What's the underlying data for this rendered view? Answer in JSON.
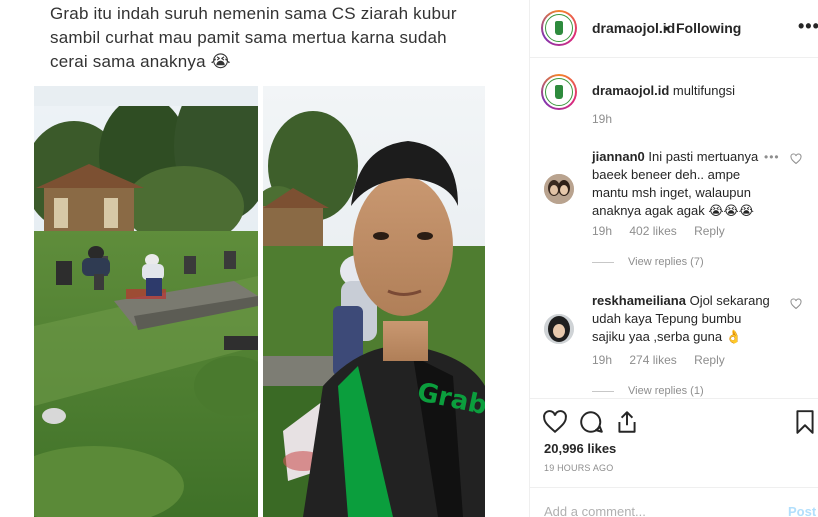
{
  "post": {
    "caption": "Grab itu indah suruh nemenin sama CS ziarah kubur sambil curhat mau pamit sama mertua karna sudah cerai sama anaknya 😭",
    "jacket_text": "Grab"
  },
  "header": {
    "username": "dramaojol.id",
    "dot": "•",
    "follow_label": "Following",
    "more_label": "•••"
  },
  "caption_comment": {
    "username": "dramaojol.id",
    "text": "multifungsi",
    "time": "19h"
  },
  "comments": [
    {
      "username": "jiannan0",
      "text": "Ini pasti mertuanya baeek beneer deh.. ampe mantu msh inget, walaupun anaknya agak agak 😭😭😭",
      "time": "19h",
      "likes": "402 likes",
      "reply_label": "Reply",
      "view_replies": "View replies (7)",
      "more_label": "•••"
    },
    {
      "username": "reskhameiliana",
      "text": "Ojol sekarang udah kaya Tepung bumbu sajiku yaa ,serba guna 👌",
      "time": "19h",
      "likes": "274 likes",
      "reply_label": "Reply",
      "view_replies": "View replies (1)"
    }
  ],
  "actions": {
    "likes": "20,996 likes",
    "time": "19 HOURS AGO"
  },
  "add_comment": {
    "placeholder": "Add a comment...",
    "post_label": "Post"
  },
  "colors": {
    "grab_green": "#0b9e3d",
    "link_blue": "#b2dffc",
    "meta_gray": "#8e8e8e"
  }
}
